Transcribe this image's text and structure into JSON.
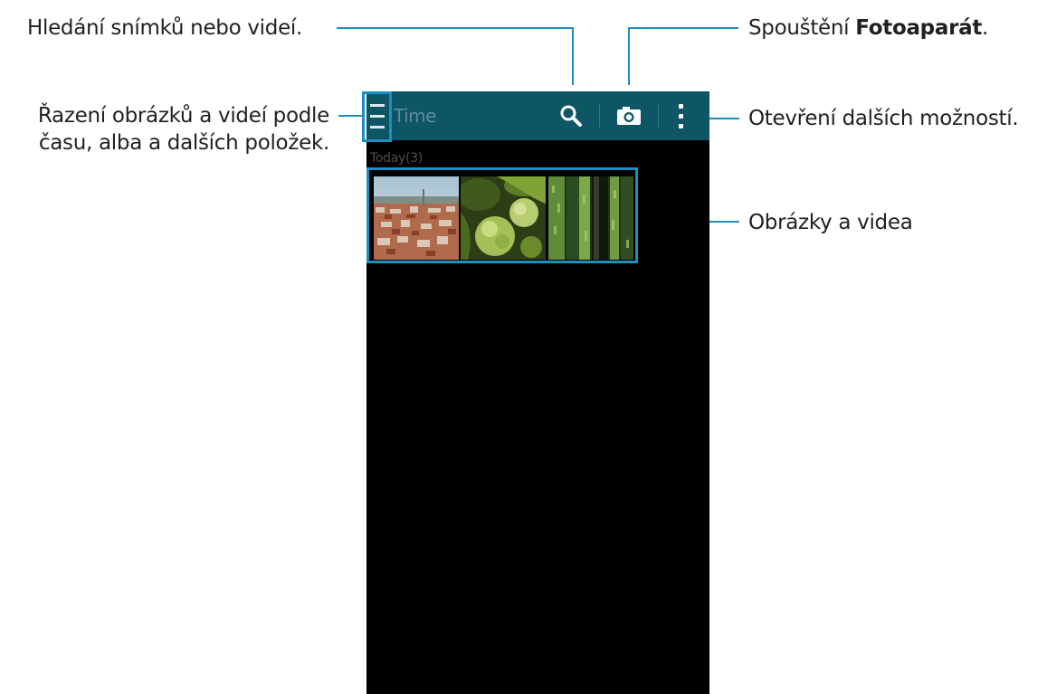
{
  "annotations": {
    "search": "Hledání snímků nebo videí.",
    "camera_prefix": "Spouštění ",
    "camera_bold": "Fotoaparát",
    "camera_suffix": ".",
    "sort_line1": "Řazení obrázků a videí podle",
    "sort_line2": "času, alba a dalších položek.",
    "more": "Otevření dalších možností.",
    "media": "Obrázky a videa"
  },
  "app": {
    "actionbar": {
      "title": "Time",
      "menu_icon": "hamburger-menu-icon",
      "search_icon": "search-icon",
      "camera_icon": "camera-icon",
      "more_icon": "more-vertical-icon"
    },
    "section_header": "Today(3)",
    "thumbnails": [
      "cityscape",
      "green-flower-buds",
      "forest-tree-trunks"
    ]
  },
  "colors": {
    "callout_line": "#1a8fc0",
    "actionbar": "#0e5566",
    "background": "#000000"
  }
}
